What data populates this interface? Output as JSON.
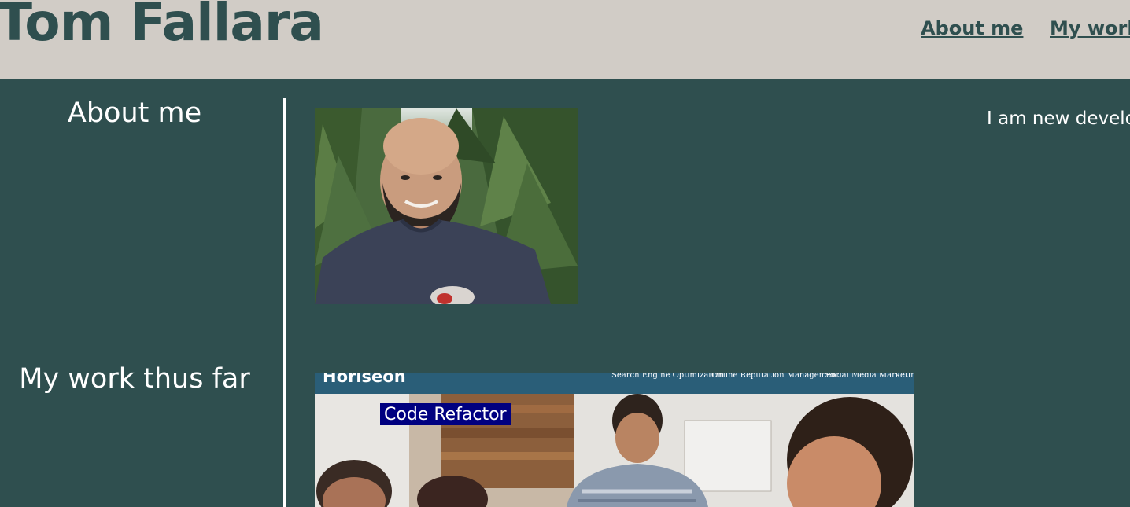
{
  "header": {
    "title": "Tom Fallara",
    "nav": [
      {
        "label": "About me"
      },
      {
        "label": "My work"
      }
    ]
  },
  "sections": {
    "about": {
      "heading": "About me",
      "intro_text": "I am new develo"
    },
    "work": {
      "heading": "My work thus far",
      "projects": [
        {
          "label": "Code Refactor",
          "screenshot": {
            "brand": "Horiseon",
            "nav": [
              "Search Engine Optimization",
              "Online Reputation Management",
              "Social Media Marketing"
            ]
          }
        }
      ]
    }
  },
  "colors": {
    "page_background": "#2f4f4f",
    "header_background": "#d1ccc6",
    "label_background": "#000080",
    "text_light": "#ffffff"
  }
}
